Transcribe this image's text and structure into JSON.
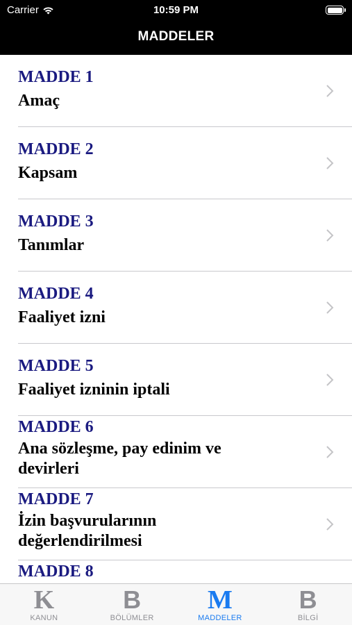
{
  "status_bar": {
    "carrier": "Carrier",
    "time": "10:59 PM",
    "wifi_icon": "wifi-icon",
    "battery_icon": "battery-icon"
  },
  "nav": {
    "title": "MADDELER"
  },
  "articles": [
    {
      "number": "MADDE 1",
      "title": "Amaç"
    },
    {
      "number": "MADDE 2",
      "title": "Kapsam"
    },
    {
      "number": "MADDE 3",
      "title": "Tanımlar"
    },
    {
      "number": "MADDE 4",
      "title": "Faaliyet izni"
    },
    {
      "number": "MADDE 5",
      "title": "Faaliyet izninin iptali"
    },
    {
      "number": "MADDE 6",
      "title": "Ana sözleşme, pay edinim ve devirleri"
    },
    {
      "number": "MADDE 7",
      "title": "İzin başvurularının değerlendirilmesi"
    },
    {
      "number": "MADDE 8",
      "title": ""
    }
  ],
  "tabs": [
    {
      "glyph": "K",
      "label": "KANUN",
      "active": false
    },
    {
      "glyph": "B",
      "label": "BÖLÜMLER",
      "active": false
    },
    {
      "glyph": "M",
      "label": "MADDELER",
      "active": true
    },
    {
      "glyph": "B",
      "label": "BİLGİ",
      "active": false
    }
  ],
  "colors": {
    "article_number": "#1a1a80",
    "tab_active": "#1a7bf0",
    "tab_inactive": "#8e8e93",
    "bar_background": "#000000"
  }
}
